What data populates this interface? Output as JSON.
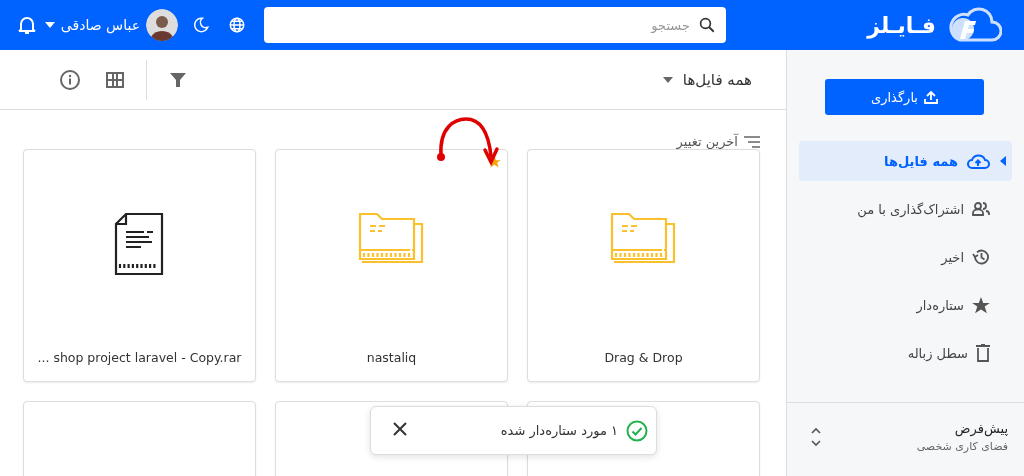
{
  "header": {
    "logo_text": "فـایـلز",
    "search": {
      "placeholder": "جستجو"
    },
    "user_name": "عباس صادقی"
  },
  "toolbar": {
    "title": "همه فایل‌ها"
  },
  "sort": {
    "label": "آخرین تغییر"
  },
  "files": [
    {
      "kind": "folder",
      "name": "Drag & Drop",
      "starred": false
    },
    {
      "kind": "folder",
      "name": "nastaliq",
      "starred": true
    },
    {
      "kind": "file",
      "name": "... shop project laravel - Copy.rar",
      "starred": false
    },
    {
      "kind": "blank"
    },
    {
      "kind": "blank"
    },
    {
      "kind": "blank"
    }
  ],
  "sidebar": {
    "upload_button": "بارگذاری",
    "items": [
      {
        "kind": "cloud",
        "label": "همه فایل‌ها",
        "selected": true
      },
      {
        "kind": "people",
        "label": "اشتراک‌گذاری با من",
        "selected": false
      },
      {
        "kind": "history",
        "label": "اخیر",
        "selected": false
      },
      {
        "kind": "star",
        "label": "ستاره‌دار",
        "selected": false
      },
      {
        "kind": "trash",
        "label": "سطل زباله",
        "selected": false
      }
    ],
    "workspace": {
      "title": "پیش‌فرض",
      "subtitle": "فضای کاری شخصی"
    }
  },
  "toast": {
    "message": "۱ مورد ستاره‌دار شده"
  }
}
